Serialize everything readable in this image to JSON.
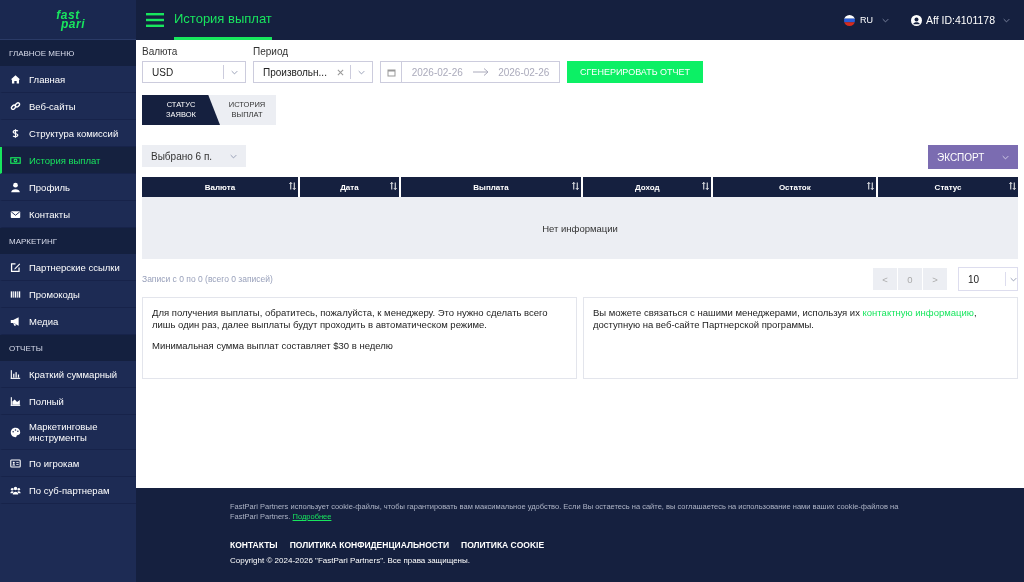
{
  "logo": {
    "line_1": "fast",
    "line_2": "pari"
  },
  "header": {
    "title": "История выплат",
    "language": "RU",
    "account": "Aff ID:4101178"
  },
  "sidebar": {
    "sections": [
      {
        "title": "ГЛАВНОЕ МЕНЮ",
        "items": [
          {
            "label": "Главная",
            "selected": false
          },
          {
            "label": "Веб-сайты",
            "selected": false
          },
          {
            "label": "Структура комиссий",
            "selected": false
          },
          {
            "label": "История выплат",
            "selected": true
          },
          {
            "label": "Профиль",
            "selected": false
          },
          {
            "label": "Контакты",
            "selected": false
          }
        ]
      },
      {
        "title": "МАРКЕТИНГ",
        "items": [
          {
            "label": "Партнерские ссылки",
            "selected": false
          },
          {
            "label": "Промокоды",
            "selected": false
          },
          {
            "label": "Медиа",
            "selected": false
          }
        ]
      },
      {
        "title": "ОТЧЕТЫ",
        "items": [
          {
            "label": "Краткий суммарный",
            "selected": false
          },
          {
            "label": "Полный",
            "selected": false
          },
          {
            "label": "Маркетинговые инструменты",
            "selected": false
          },
          {
            "label": "По игрокам",
            "selected": false
          },
          {
            "label": "По суб-партнерам",
            "selected": false
          }
        ]
      }
    ]
  },
  "filters": {
    "currency_label": "Валюта",
    "currency_value": "USD",
    "period_label": "Период",
    "period_value": "Произвольн...",
    "date_from": "2026-02-26",
    "date_to": "2026-02-26",
    "generate_button": "СГЕНЕРИРОВАТЬ ОТЧЕТ"
  },
  "tabs": [
    {
      "label": "СТАТУС ЗАЯВОК",
      "selected": true
    },
    {
      "label": "ИСТОРИЯ ВЫПЛАТ",
      "selected": false
    }
  ],
  "columns_picker": "Выбрано 6 п.",
  "export_button": "ЭКСПОРТ",
  "table": {
    "columns": [
      "Валюта",
      "Дата",
      "Выплата",
      "Доход",
      "Остаток",
      "Статус"
    ],
    "empty_text": "Нет информации"
  },
  "records_info": "Записи с 0 по 0 (всего 0 записей)",
  "pagination": {
    "prev": "<",
    "page": "0",
    "next": ">",
    "page_size": "10"
  },
  "notes": [
    {
      "paragraphs": [
        "Для получения выплаты, обратитесь, пожалуйста, к менеджеру. Это нужно сделать всего лишь один раз, далее выплаты будут проходить в автоматическом режиме.",
        "Минимальная сумма выплат составляет $30 в неделю"
      ]
    },
    {
      "text_before": "Вы можете связаться с нашими менеджерами, используя их ",
      "link": "контактную информацию",
      "text_after": ", доступную на веб-сайте Партнерской программы."
    }
  ],
  "footer": {
    "cookie_text": "FastPari Partners использует cookie-файлы, чтобы гарантировать вам максимальное удобство. Если Вы остаетесь на сайте, вы соглашаетесь на использование нами ваших cookie-файлов на FastPari Partners. ",
    "cookie_link": "Подробнее",
    "links": [
      "КОНТАКТЫ",
      "ПОЛИТИКА КОНФИДЕНЦИАЛЬНОСТИ",
      "ПОЛИТИКА COOKIE"
    ],
    "copyright": "Copyright © 2024-2026 \"FastPari Partners\". Все права защищены."
  }
}
